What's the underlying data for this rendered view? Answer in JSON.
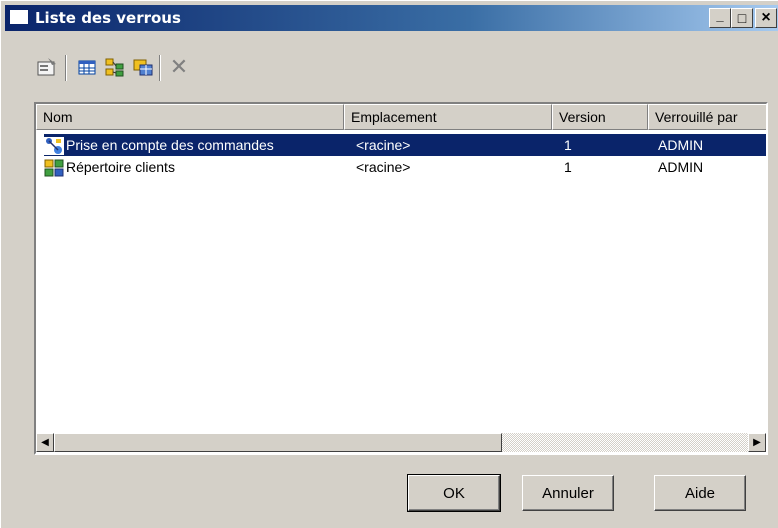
{
  "window": {
    "title": "Liste des verrous",
    "controls": {
      "minimize": "_",
      "maximize": "□",
      "close": "×"
    }
  },
  "toolbar": {
    "tools": [
      {
        "icon": "properties-icon"
      },
      {
        "icon": "table-view-icon"
      },
      {
        "icon": "tree-view-icon"
      },
      {
        "icon": "grid-view-icon"
      },
      {
        "icon": "delete-icon",
        "glyph": "✕"
      }
    ]
  },
  "list": {
    "columns": [
      "Nom",
      "Emplacement",
      "Version",
      "Verrouillé par"
    ],
    "rows": [
      {
        "icon": "model-icon",
        "name": "Prise en compte des commandes",
        "location": "<racine>",
        "version": "1",
        "locked_by": "ADMIN",
        "selected": true
      },
      {
        "icon": "directory-icon",
        "name": "Répertoire clients",
        "location": "<racine>",
        "version": "1",
        "locked_by": "ADMIN",
        "selected": false
      }
    ]
  },
  "scrollbar": {
    "left_arrow": "◀",
    "right_arrow": "▶"
  },
  "buttons": {
    "ok": "OK",
    "cancel": "Annuler",
    "help": "Aide"
  },
  "colors": {
    "selection": "#0a246a",
    "face": "#d4d0c8",
    "titlebar_start": "#0a246a",
    "titlebar_end": "#a6caf0"
  }
}
